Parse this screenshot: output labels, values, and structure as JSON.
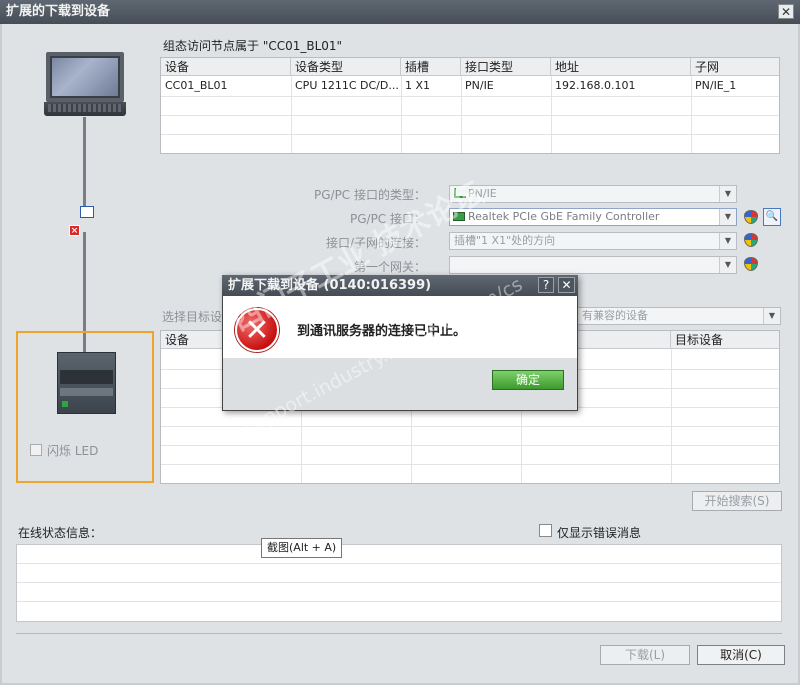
{
  "window": {
    "title": "扩展的下载到设备",
    "close_glyph": "✕"
  },
  "diagram": {
    "flash_led_label": "闪烁 LED"
  },
  "config_section": {
    "title": "组态访问节点属于 \"CC01_BL01\"",
    "columns": [
      "设备",
      "设备类型",
      "插槽",
      "接口类型",
      "地址",
      "子网"
    ],
    "rows": [
      [
        "CC01_BL01",
        "CPU 1211C DC/D...",
        "1 X1",
        "PN/IE",
        "192.168.0.101",
        "PN/IE_1"
      ]
    ]
  },
  "interface_form": {
    "rows": [
      {
        "label": "PG/PC 接口的类型：",
        "value": "PN/IE"
      },
      {
        "label": "PG/PC 接口：",
        "value": "Realtek PCIe GbE Family Controller"
      },
      {
        "label": "接口/子网的连接：",
        "value": "插槽\"1 X1\"处的方向"
      },
      {
        "label": "第一个网关：",
        "value": ""
      }
    ]
  },
  "target_section": {
    "label": "选择目标设",
    "compat_value": "有兼容的设备",
    "columns": [
      "设备",
      "目标设备"
    ]
  },
  "search_button": "开始搜索(S)",
  "status": {
    "label": "在线状态信息：",
    "only_errors_label": "仅显示错误消息",
    "tooltip": "截图(Alt + A)"
  },
  "buttons": {
    "download": "下载(L)",
    "cancel": "取消(C)"
  },
  "modal": {
    "title": "扩展下载到设备 (0140:016399)",
    "help": "?",
    "close": "✕",
    "message": "到通讯服务器的连接已中止。",
    "ok": "确定"
  },
  "watermark": {
    "line1": "西门子工业  技术论坛",
    "line2": "support.industry.siemens.com/cs"
  },
  "colors": {
    "accent": "#f0a52a",
    "error": "#d32020",
    "ok_green": "#4aa836"
  }
}
